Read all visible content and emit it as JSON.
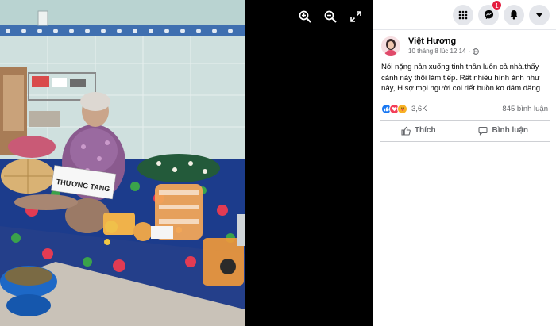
{
  "viewer": {
    "sign_text": "THƯƠNG TANG",
    "controls": [
      "zoom-in-icon",
      "zoom-out-icon",
      "fullscreen-icon"
    ]
  },
  "topbar": {
    "menu_icon": "grid-menu-icon",
    "messenger_icon": "messenger-icon",
    "messenger_badge": "1",
    "notifications_icon": "bell-icon",
    "account_icon": "caret-down-icon"
  },
  "post": {
    "author": "Việt Hương",
    "timestamp": "10 tháng 8 lúc 12:14",
    "separator": "·",
    "privacy_icon": "globe-icon",
    "text": "Nói nặng nản xuống tinh thần luôn cả nhà.thấy cảnh này thôi làm tiếp. Rất nhiều hình ảnh như này, H sợ mọi người coi riết buồn ko dám đăng.",
    "reactions": {
      "icons": [
        "like-icon",
        "love-icon",
        "care-icon"
      ],
      "count": "3,6K",
      "comments": "845 bình luận"
    },
    "actions": {
      "like_label": "Thích",
      "comment_label": "Bình luận"
    }
  },
  "colors": {
    "facebook_blue": "#1877f2",
    "love_red": "#f33e58",
    "care_yellow": "#f7b125",
    "badge_red": "#e41e3f"
  }
}
